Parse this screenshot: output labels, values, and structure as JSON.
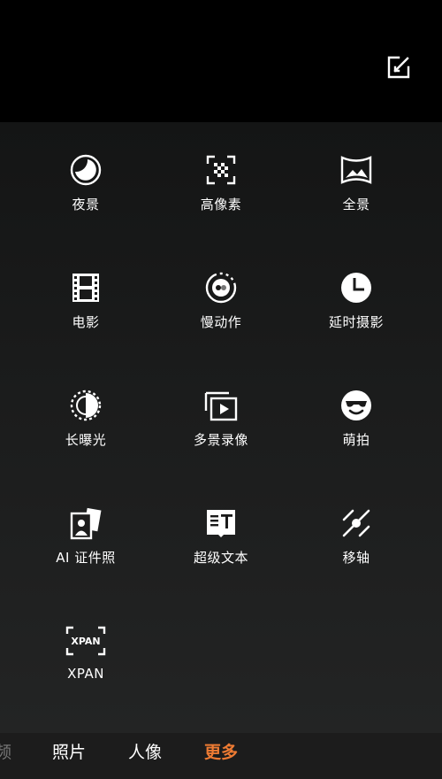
{
  "modes": [
    {
      "label": "夜景",
      "icon": "night-moon-icon"
    },
    {
      "label": "高像素",
      "icon": "high-pixel-grid-icon"
    },
    {
      "label": "全景",
      "icon": "panorama-icon"
    },
    {
      "label": "电影",
      "icon": "film-strip-icon"
    },
    {
      "label": "慢动作",
      "icon": "slow-motion-icon"
    },
    {
      "label": "延时摄影",
      "icon": "time-lapse-clock-icon"
    },
    {
      "label": "长曝光",
      "icon": "long-exposure-icon"
    },
    {
      "label": "多景录像",
      "icon": "multi-scene-video-icon"
    },
    {
      "label": "萌拍",
      "icon": "sunglasses-face-icon"
    },
    {
      "label": "AI 证件照",
      "icon": "id-photo-icon"
    },
    {
      "label": "超级文本",
      "icon": "super-text-icon"
    },
    {
      "label": "移轴",
      "icon": "tilt-shift-icon"
    },
    {
      "label": "XPAN",
      "icon": "xpan-icon",
      "icon_text": "XPAN"
    }
  ],
  "tabs": {
    "partial": "频",
    "photo": "照片",
    "portrait": "人像",
    "more": "更多"
  },
  "colors": {
    "accent": "#ee7b33",
    "background": "#1d1e1e",
    "top_bar": "#000000"
  }
}
